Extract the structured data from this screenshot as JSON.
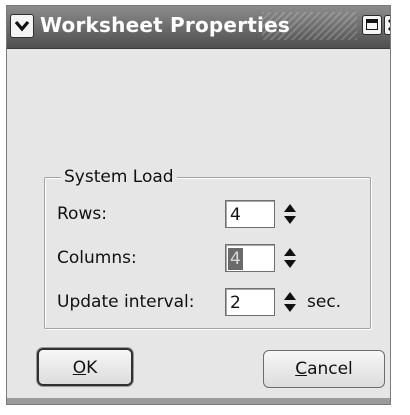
{
  "window": {
    "title": "Worksheet Properties"
  },
  "group": {
    "title": "System Load"
  },
  "fields": {
    "rows": {
      "label": "Rows:",
      "value": "4"
    },
    "columns": {
      "label": "Columns:",
      "value": "4"
    },
    "update_interval": {
      "label": "Update interval:",
      "value": "2",
      "unit": "sec."
    }
  },
  "buttons": {
    "ok": {
      "accel": "O",
      "rest": "K"
    },
    "cancel": {
      "accel": "C",
      "rest": "ancel"
    }
  },
  "icons": {
    "menu": "chevron-down-icon",
    "maximize": "maximize-icon",
    "close": "close-icon",
    "spin": "spin-arrows-icon"
  },
  "colors": {
    "titlebar": "#5e5e5e",
    "dialog_bg": "#e6e6e6",
    "selection": "#6a6a6a"
  }
}
